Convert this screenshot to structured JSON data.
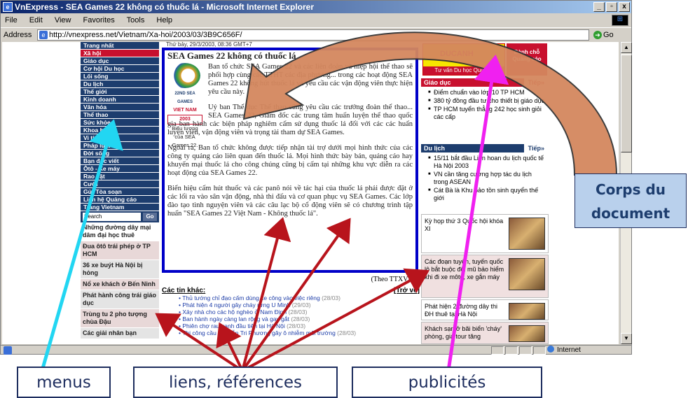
{
  "window": {
    "title": "VnExpress - SEA Games 22 không có thuốc lá - Microsoft Internet Explorer",
    "minimize": "_",
    "maximize": "▫",
    "close": "x"
  },
  "menubar": [
    "File",
    "Edit",
    "View",
    "Favorites",
    "Tools",
    "Help"
  ],
  "address": {
    "label": "Address",
    "url": "http://vnexpress.net/Vietnam/Xa-hoi/2003/03/3B9C656F/",
    "go": "Go"
  },
  "status": {
    "zone": "Internet"
  },
  "nav": {
    "items": [
      "Trang nhất",
      "Xã hội",
      "Giáo dục",
      "Cơ hội Du học",
      "Lối sống",
      "Du lịch",
      "Thế giới",
      "Kinh doanh",
      "Văn hóa",
      "Thể thao",
      "Sức khỏe",
      "Khoa học",
      "Vi tính",
      "Pháp luật",
      "Đời sống",
      "Bạn đọc viết",
      "Ôtô - Xe máy",
      "Rao vặt",
      "Cười",
      "Gửi Tòa soạn",
      "Liên hệ Quảng cáo",
      "Trang Vietnam"
    ],
    "active_index": 1,
    "search_placeholder": "Search",
    "search_go": "Go"
  },
  "side_news": [
    "Những đường dây mại dâm đại học thuê",
    "Đua ôtô trái phép ở TP HCM",
    "36 xe buýt Hà Nội bị hỏng",
    "Nổ xe khách ở Bến Ninh",
    "Phát hành công trái giáo dục",
    "Trùng tu 2 pho tượng chùa Đậu",
    "Các giải nhân bạn"
  ],
  "article": {
    "date": "Thứ bảy, 29/3/2003, 08:36 GMT+7",
    "title": "SEA Games 22 không có thuốc lá",
    "logo_line1": "22ND SEA GAMES",
    "logo_line2": "VIET NAM",
    "logo_line3": "2003",
    "caption": "Biểu tượng của SEA Games 22.",
    "p1": "Ban tổ chức SEA Games 22 và các liên đoàn và hiệp hội thể thao sẽ phối hợp cùng các TTHT các địa phương... trong các hoạt động SEA Games 22 không hút thuốc lá và yêu cầu các vận động viên thực hiện yêu cầu này.",
    "p2": "Uỷ ban Thể dục Thể thao cũng yêu cầu các trưởng đoàn thể thao... SEA Games 22, Giám đốc các trung tâm huấn luyện thể thao quốc gia ban hành các biện pháp nghiêm cấm sử dụng thuốc lá đối với các các huấn luyện viên, vận động viên và trọng tài tham dự SEA Games.",
    "p3": "Ngoài ra, Ban tổ chức không được tiếp nhận tài trợ dưới mọi hình thức của các công ty quảng cáo liên quan đến thuốc lá. Mọi hình thức bày bán, quảng cáo hay khuyến mại thuốc lá cho công chúng cũng bị cấm tại những khu vực diễn ra các hoạt động của SEA Games 22.",
    "p4": "Biển hiệu cấm hút thuốc và các panô nói về tác hại của thuốc lá phải được đặt ở các lối ra vào sân vận động, nhà thi đấu và cơ quan phục vụ SEA Games. Các lớp đào tạo tình nguyện viên và các câu lạc bộ cổ động viên sẽ có chương trình tập huấn \"SEA Games 22 Việt Nam - Không thuốc lá\".",
    "source": "(Theo TTXVN)"
  },
  "other_news": {
    "heading": "Các tin khác:",
    "more": "[Trở về]",
    "items": [
      {
        "text": "Thủ tướng chỉ đạo cấm dùng xe công vào việc riêng",
        "date": "(28/03)"
      },
      {
        "text": "Phát hiện 4 người gây cháy rừng U Minh",
        "date": "(29/03)"
      },
      {
        "text": "Xảy nhà cho các hộ nghèo ở Nam Định",
        "date": "(28/03)"
      },
      {
        "text": "Ban hành ngày càng lan rộng và gay gắt",
        "date": "(28/03)"
      },
      {
        "text": "Phiên chợ rau xanh đầu tiên tại Hà Nội",
        "date": "(28/03)"
      },
      {
        "text": "Thi công cầu Nguyễn Tri Phương gây ô nhiễm môi trường",
        "date": "(28/03)"
      }
    ]
  },
  "right": {
    "ad1_brand": "DUCANH",
    "ad1_sub": "Tư vấn Du học Quốc tế",
    "ad2": "Dành chỗ Quảng cáo",
    "sections": [
      {
        "title": "Giáo dục",
        "more": "Tiếp»",
        "items": [
          "Điểm chuẩn vào lớp 10 TP HCM",
          "380 tỷ đồng đầu tư cho thiết bị giáo dục",
          "TP HCM tuyển thẳng 242 học sinh giỏi các cấp"
        ]
      },
      {
        "title": "Du lịch",
        "more": "Tiếp»",
        "items": [
          "15/11 bắt đầu Liên hoan du lịch quốc tế Hà Nội 2003",
          "VN cần tăng cường hợp tác du lịch trong ASEAN",
          "Cát Bà là Khu bảo tồn sinh quyển thế giới"
        ]
      }
    ],
    "promos": [
      "Kỳ họp thứ 3 Quốc hội khóa XI",
      "Các đoạn tuyến, tuyến quốc lộ bắt buộc đội mũ bảo hiểm khi đi xe môtô, xe gắn máy",
      "Phát hiện 2 đường dây thi ĐH thuê tại Hà Nội",
      "Khách sạn ở bãi biển 'cháy' phòng, giá tour tăng"
    ]
  },
  "annotations": {
    "corps_line1": "Corps du",
    "corps_line2": "document",
    "menus": "menus",
    "liens": "liens, références",
    "pubs": "publicités",
    "colors": {
      "arrow_red": "#b8141c",
      "arrow_cyan": "#22d6f2",
      "arrow_magenta": "#f020f0",
      "curve_fill": "#d4875e"
    }
  }
}
